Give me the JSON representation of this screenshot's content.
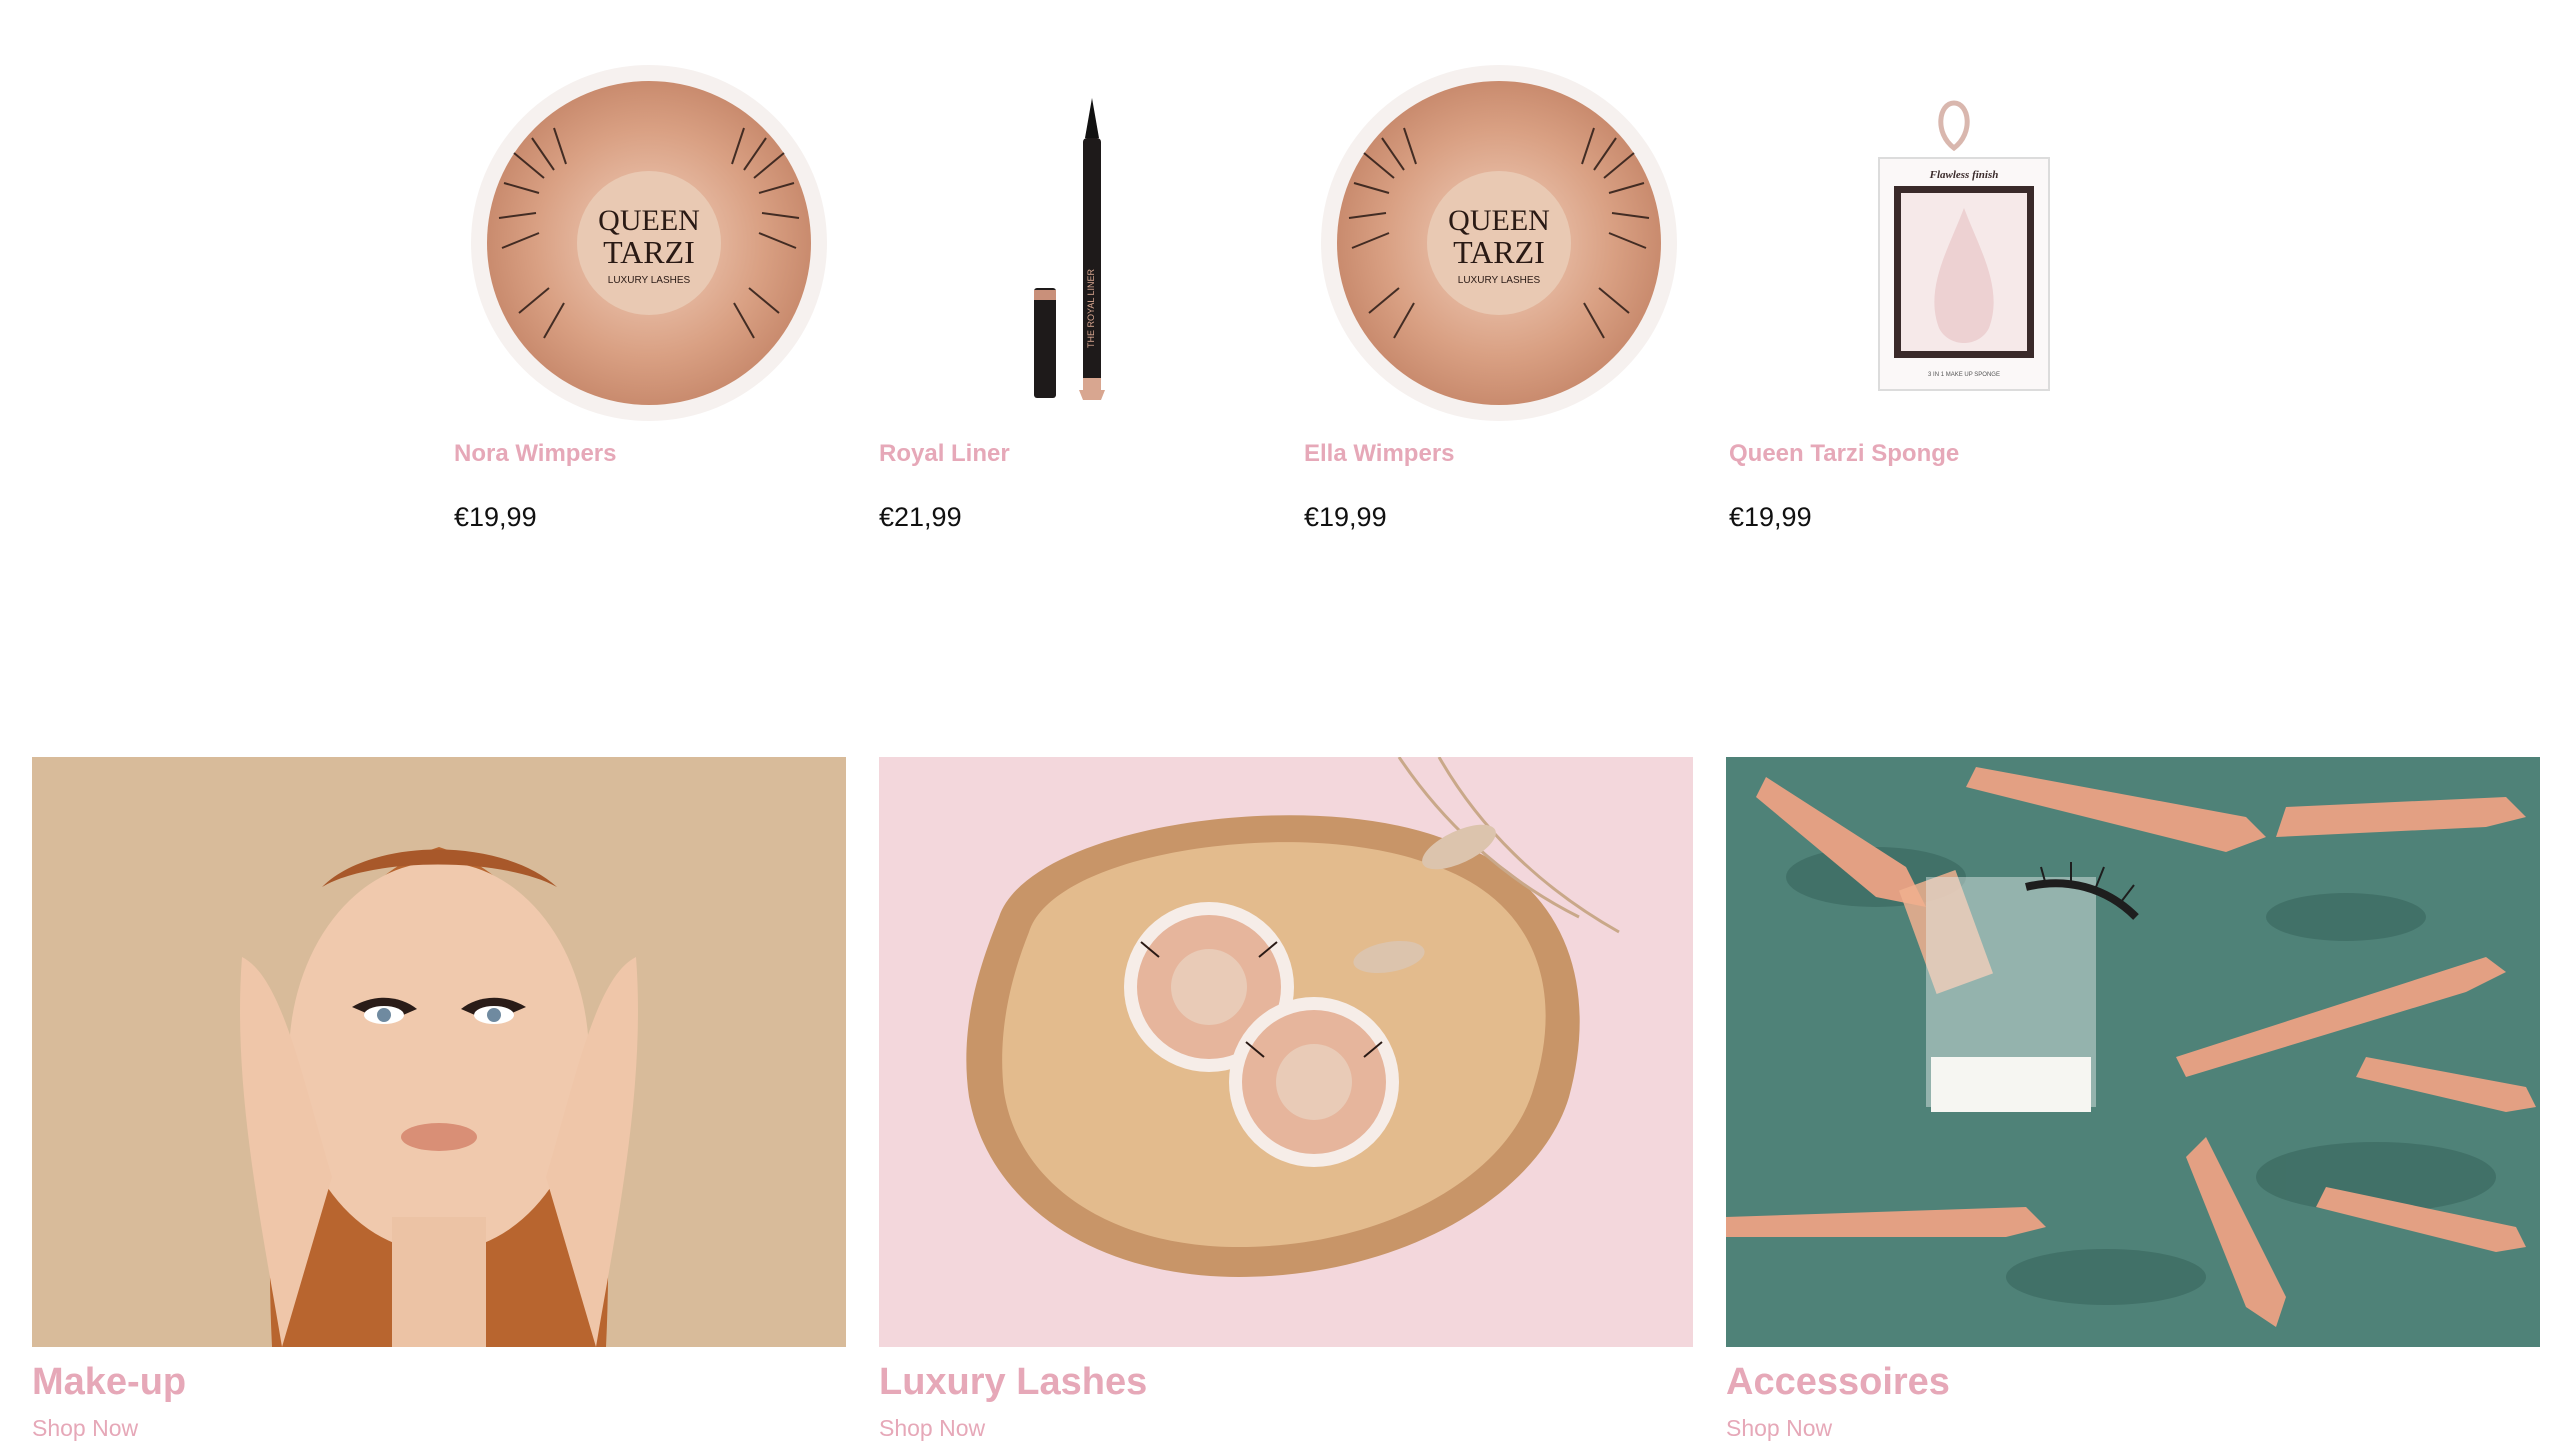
{
  "products": [
    {
      "name": "Nora Wimpers",
      "price": "€19,99",
      "image_icon": "lash-box-icon"
    },
    {
      "name": "Royal Liner",
      "price": "€21,99",
      "image_icon": "eyeliner-pen-icon"
    },
    {
      "name": "Ella Wimpers",
      "price": "€19,99",
      "image_icon": "lash-box-icon"
    },
    {
      "name": "Queen Tarzi Sponge",
      "price": "€19,99",
      "image_icon": "makeup-sponge-box-icon"
    }
  ],
  "lash_box": {
    "brand_top": "QUEEN",
    "brand_bottom": "TARZI",
    "tagline": "LUXURY LASHES"
  },
  "sponge_box": {
    "label_top": "Flawless finish",
    "label_bottom": "3 IN 1 MAKE UP SPONGE"
  },
  "liner": {
    "pen_text": "THE ROYAL LINER"
  },
  "categories": [
    {
      "title": "Make-up",
      "cta": "Shop Now"
    },
    {
      "title": "Luxury Lashes",
      "cta": "Shop Now"
    },
    {
      "title": "Accessoires",
      "cta": "Shop Now"
    }
  ],
  "colors": {
    "accent_pink": "#e6a8b8",
    "price_text": "#111111",
    "rose_gold": "#e4a58a"
  }
}
